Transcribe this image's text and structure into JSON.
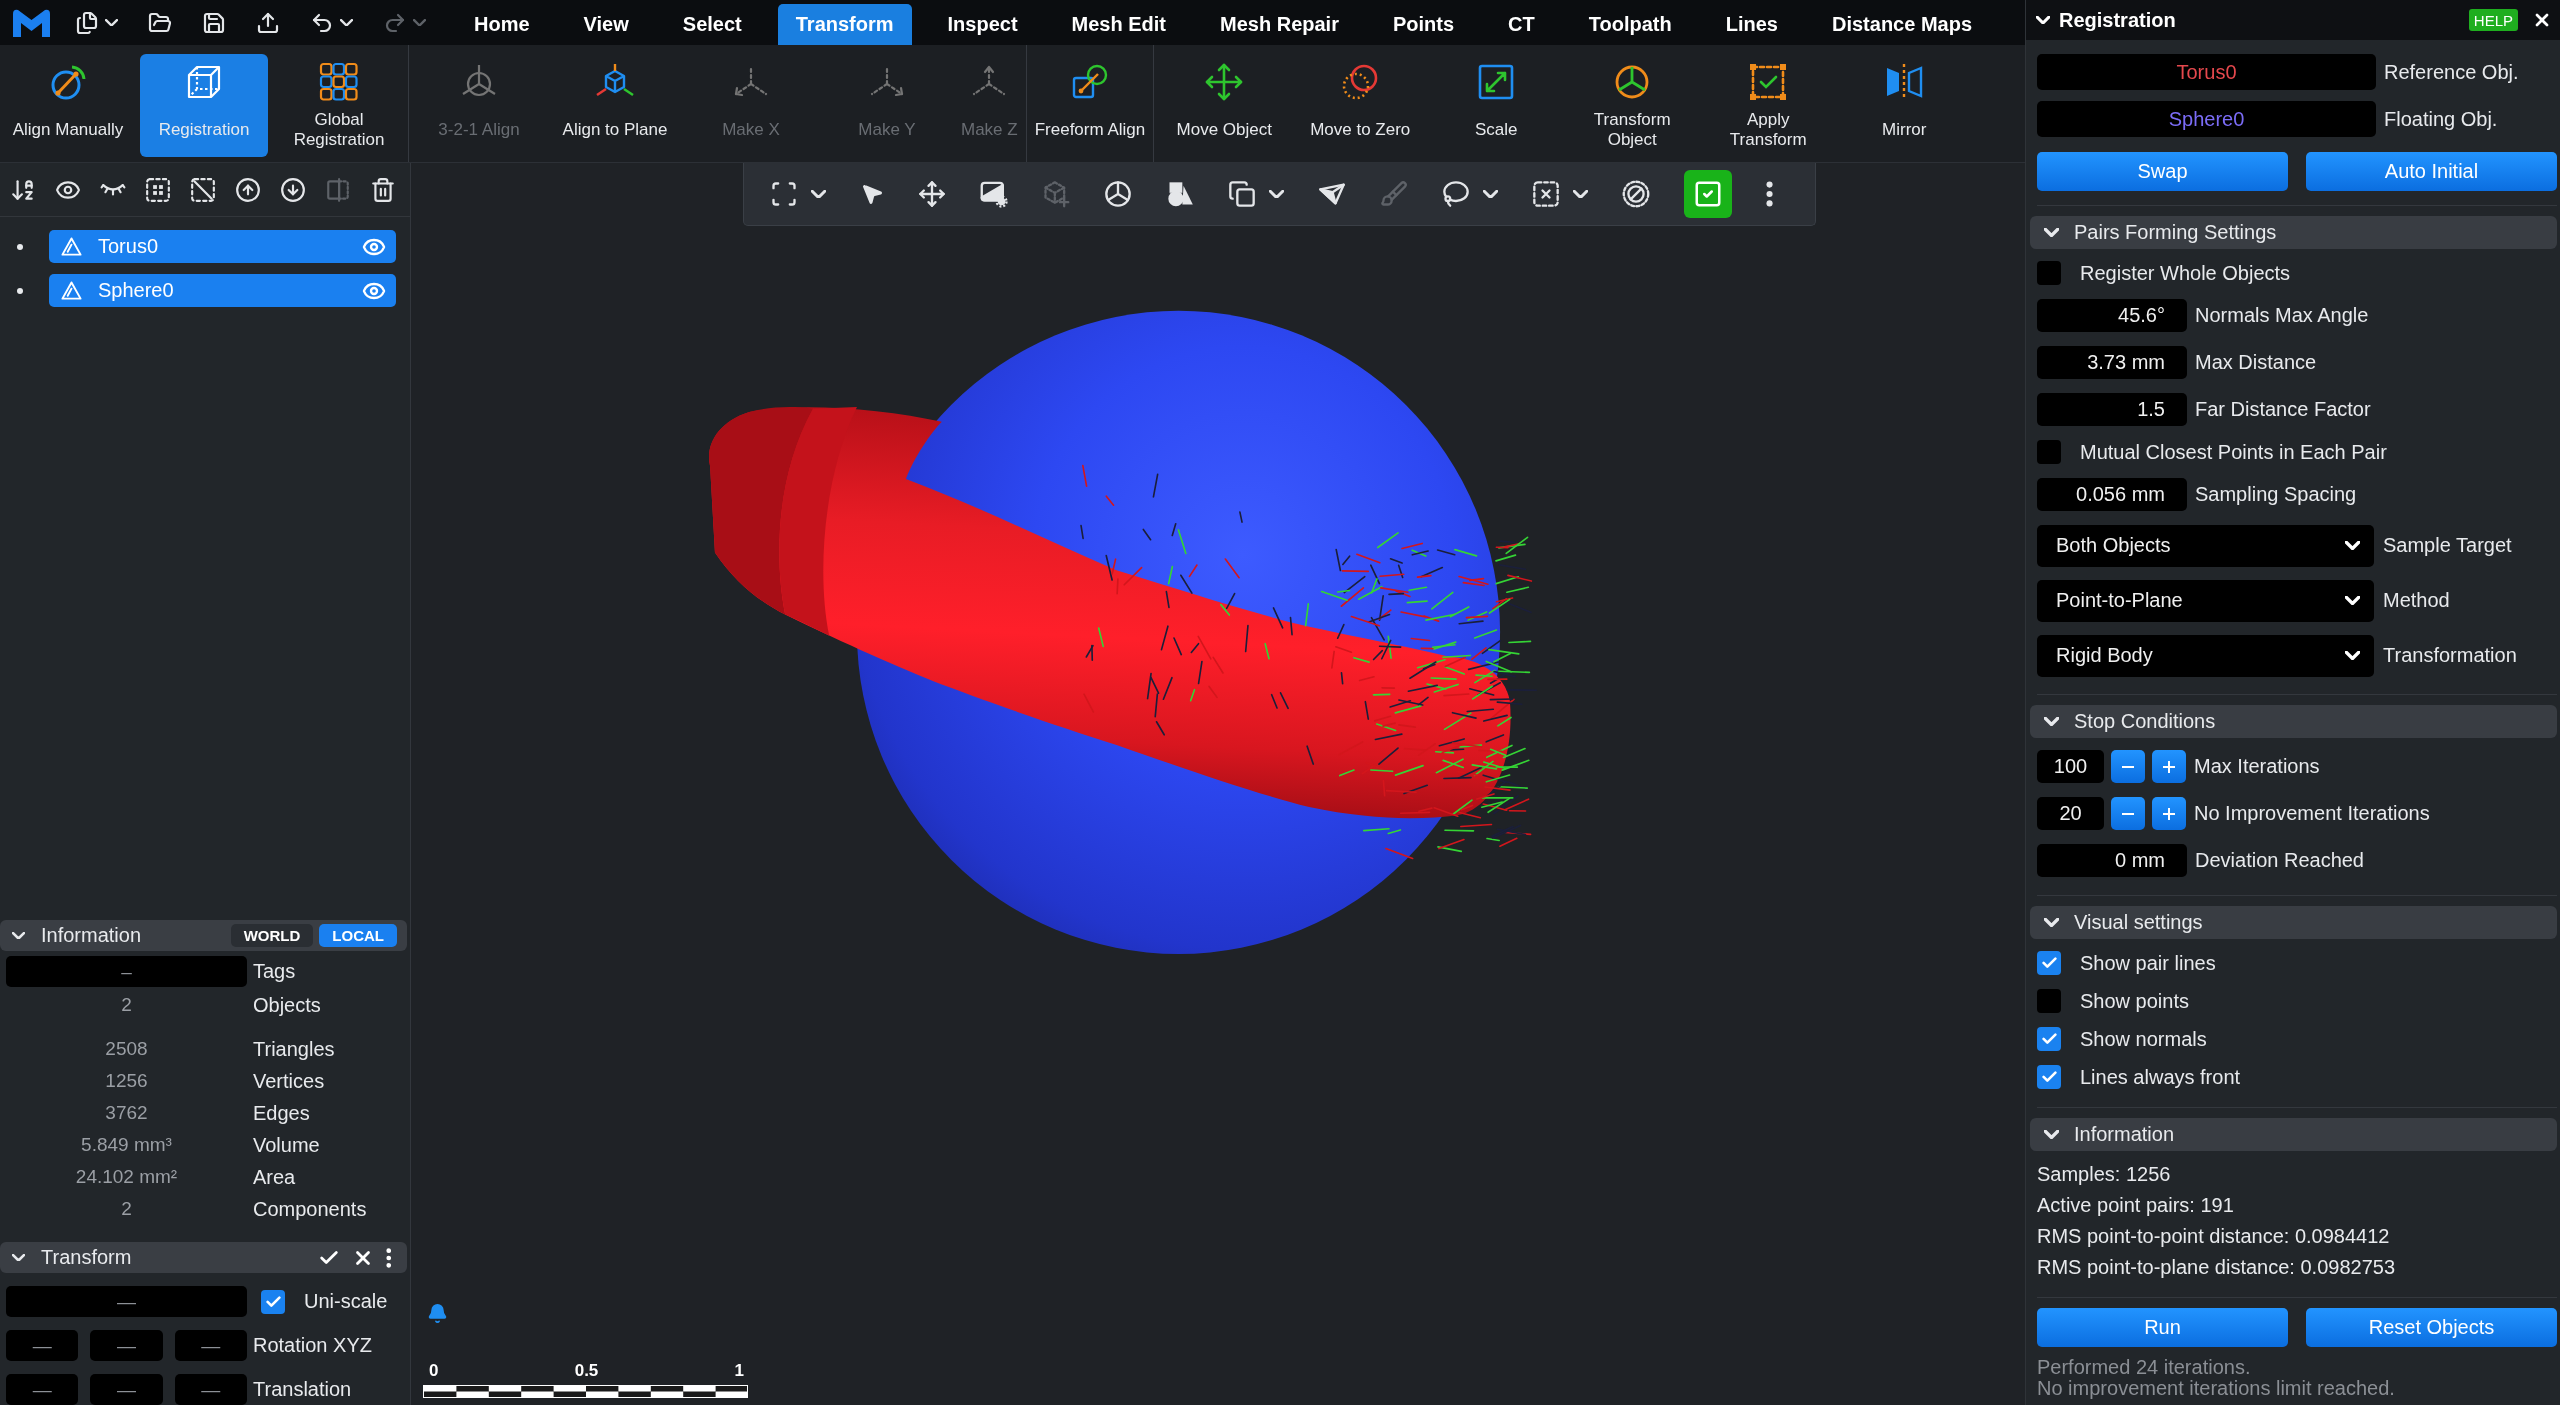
{
  "menubar": {
    "quick_tools": [
      {
        "disabled": false
      },
      {
        "disabled": false
      },
      {
        "disabled": false
      },
      {
        "disabled": false
      },
      {
        "disabled": false
      },
      {
        "disabled": true
      }
    ],
    "tabs": [
      {
        "label": "Home",
        "selected": false
      },
      {
        "label": "View",
        "selected": false
      },
      {
        "label": "Select",
        "selected": false
      },
      {
        "label": "Transform",
        "selected": true
      },
      {
        "label": "Inspect",
        "selected": false
      },
      {
        "label": "Mesh Edit",
        "selected": false
      },
      {
        "label": "Mesh Repair",
        "selected": false
      },
      {
        "label": "Points",
        "selected": false
      },
      {
        "label": "CT",
        "selected": false
      },
      {
        "label": "Toolpath",
        "selected": false
      },
      {
        "label": "Lines",
        "selected": false
      },
      {
        "label": "Distance Maps",
        "selected": false
      }
    ]
  },
  "ribbon": {
    "groups": [
      {
        "items": [
          {
            "label": "Align Manually",
            "selected": false,
            "disabled": false
          },
          {
            "label": "Registration",
            "selected": true,
            "disabled": false
          },
          {
            "label": "Global Registration",
            "selected": false,
            "disabled": false
          }
        ]
      },
      {
        "items": [
          {
            "label": "3-2-1 Align",
            "selected": false,
            "disabled": true
          },
          {
            "label": "Align to Plane",
            "selected": false,
            "disabled": false
          },
          {
            "label": "Make X",
            "selected": false,
            "disabled": true
          },
          {
            "label": "Make Y",
            "selected": false,
            "disabled": true
          },
          {
            "label": "Make Z",
            "selected": false,
            "disabled": true
          }
        ]
      },
      {
        "items": [
          {
            "label": "Freeform Align",
            "selected": false,
            "disabled": false
          }
        ]
      },
      {
        "items": [
          {
            "label": "Move Object",
            "selected": false,
            "disabled": false
          },
          {
            "label": "Move to Zero",
            "selected": false,
            "disabled": false
          },
          {
            "label": "Scale",
            "selected": false,
            "disabled": false
          },
          {
            "label": "Transform Object",
            "selected": false,
            "disabled": false
          },
          {
            "label": "Apply Transform",
            "selected": false,
            "disabled": false
          },
          {
            "label": "Mirror",
            "selected": false,
            "disabled": false
          }
        ]
      }
    ]
  },
  "scene": {
    "tools": [
      {
        "disabled": false
      },
      {
        "disabled": false
      },
      {
        "disabled": false
      },
      {
        "disabled": false
      },
      {
        "disabled": false
      },
      {
        "disabled": false
      },
      {
        "disabled": false
      },
      {
        "disabled": true
      },
      {
        "disabled": false
      }
    ],
    "objects": [
      {
        "name": "Torus0",
        "selected": true,
        "visible": true
      },
      {
        "name": "Sphere0",
        "selected": true,
        "visible": true
      }
    ]
  },
  "information": {
    "title": "Information",
    "expanded": true,
    "modes": [
      {
        "label": "WORLD",
        "selected": false
      },
      {
        "label": "LOCAL",
        "selected": true
      }
    ],
    "tags": {
      "value": "–",
      "label": "Tags"
    },
    "groups": [
      {
        "rows": [
          {
            "value": "2",
            "label": "Objects"
          }
        ]
      },
      {
        "rows": [
          {
            "value": "2508",
            "label": "Triangles"
          },
          {
            "value": "1256",
            "label": "Vertices"
          },
          {
            "value": "3762",
            "label": "Edges"
          },
          {
            "value": "5.849 mm³",
            "label": "Volume"
          },
          {
            "value": "24.102 mm²",
            "label": "Area"
          },
          {
            "value": "2",
            "label": "Components"
          }
        ]
      }
    ]
  },
  "transform": {
    "title": "Transform",
    "expanded": true,
    "uni_scale": {
      "value": "—",
      "label": "Uni-scale",
      "checked": true
    },
    "rows": [
      {
        "label": "Rotation XYZ",
        "values": [
          "—",
          "—",
          "—"
        ]
      },
      {
        "label": "Translation",
        "values": [
          "—",
          "—",
          "—"
        ]
      }
    ]
  },
  "viewport": {
    "tools": [
      {
        "disabled": false,
        "on": false
      },
      {
        "disabled": false,
        "on": false
      },
      {
        "disabled": false,
        "on": false
      },
      {
        "disabled": false,
        "on": false
      },
      {
        "disabled": true,
        "on": false
      },
      {
        "disabled": false,
        "on": false
      },
      {
        "disabled": false,
        "on": false
      },
      {
        "disabled": false,
        "on": false
      },
      {
        "disabled": false,
        "on": false
      },
      {
        "disabled": true,
        "on": false
      },
      {
        "disabled": false,
        "on": false
      },
      {
        "disabled": false,
        "on": false
      },
      {
        "disabled": false,
        "on": false
      },
      {
        "disabled": false,
        "on": true
      },
      {
        "disabled": false,
        "on": false
      }
    ],
    "scale_bar": {
      "ticks": [
        "0",
        "0.5",
        "1"
      ]
    }
  },
  "registration": {
    "title": "Registration",
    "expanded": true,
    "help": "HELP",
    "objects": [
      {
        "value": "Torus0",
        "label": "Reference Obj.",
        "color": "#e5484d"
      },
      {
        "value": "Sphere0",
        "label": "Floating Obj.",
        "color": "#7b6cf6"
      }
    ],
    "actions": [
      "Swap",
      "Auto Initial"
    ],
    "sections": [
      {
        "title": "Pairs Forming Settings",
        "expanded": true,
        "rows": [
          {
            "kind": "checkbox",
            "label": "Register Whole Objects",
            "checked": false
          },
          {
            "kind": "number",
            "value": "45.6°",
            "label": "Normals Max Angle"
          },
          {
            "kind": "number",
            "value": "3.73 mm",
            "label": "Max Distance"
          },
          {
            "kind": "number",
            "value": "1.5",
            "label": "Far Distance Factor"
          },
          {
            "kind": "checkbox",
            "label": "Mutual Closest Points in Each Pair",
            "checked": false
          },
          {
            "kind": "number",
            "value": "0.056 mm",
            "label": "Sampling Spacing"
          },
          {
            "kind": "select",
            "value": "Both Objects",
            "label": "Sample Target"
          },
          {
            "kind": "select",
            "value": "Point-to-Plane",
            "label": "Method"
          },
          {
            "kind": "select",
            "value": "Rigid Body",
            "label": "Transformation"
          }
        ]
      },
      {
        "title": "Stop Conditions",
        "expanded": true,
        "rows": [
          {
            "kind": "stepper",
            "value": "100",
            "label": "Max Iterations"
          },
          {
            "kind": "stepper",
            "value": "20",
            "label": "No Improvement Iterations"
          },
          {
            "kind": "number",
            "value": "0 mm",
            "label": "Deviation Reached"
          }
        ]
      },
      {
        "title": "Visual settings",
        "expanded": true,
        "rows": [
          {
            "kind": "checkbox",
            "label": "Show pair lines",
            "checked": true
          },
          {
            "kind": "checkbox",
            "label": "Show points",
            "checked": false
          },
          {
            "kind": "checkbox",
            "label": "Show normals",
            "checked": true
          },
          {
            "kind": "checkbox",
            "label": "Lines always front",
            "checked": true
          }
        ]
      },
      {
        "title": "Information",
        "expanded": true,
        "rows": [
          {
            "kind": "text",
            "text": "Samples: 1256"
          },
          {
            "kind": "text",
            "text": "Active point pairs: 191"
          },
          {
            "kind": "text",
            "text": "RMS point-to-point distance: 0.0984412"
          },
          {
            "kind": "text",
            "text": "RMS point-to-plane distance: 0.0982753"
          }
        ]
      }
    ],
    "buttons": [
      "Run",
      "Reset Objects"
    ],
    "status": [
      "Performed 24 iterations.",
      "No improvement iterations limit reached."
    ]
  }
}
